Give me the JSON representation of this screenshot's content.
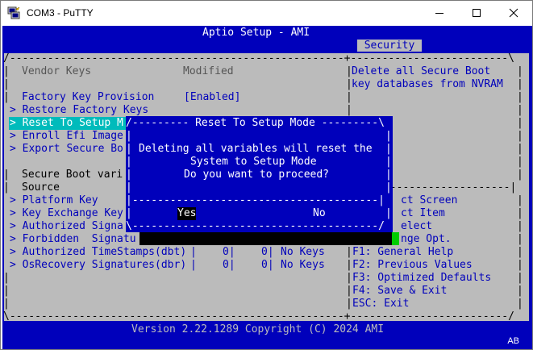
{
  "window": {
    "title": "COM3 - PuTTY"
  },
  "header": {
    "title": "Aptio Setup - AMI",
    "active_tab": "Security"
  },
  "main": {
    "col_header_left": "Vendor Keys",
    "col_header_value": "Modified",
    "help_line1": "Delete all Secure Boot",
    "help_line2": "key databases from NVRAM",
    "factory_key_provision": {
      "label": "Factory Key Provision",
      "value": "[Enabled]"
    },
    "restore_factory_keys": "> Restore Factory Keys",
    "reset_to_setup_mode": "> Reset To Setup M",
    "enroll_efi_image": "> Enroll Efi Image",
    "export_secure_boot": "> Export Secure Bo",
    "secure_boot_vari": "Secure Boot vari",
    "source": "Source",
    "platform_key": "> Platform Key",
    "key_exchange_key": "> Key Exchange Key",
    "authorized_signa": "> Authorized Signa",
    "forbidden_signatu": "> Forbidden  Signatu",
    "authorized_timestamps": {
      "label": "> Authorized TimeStamps(dbt)",
      "sep1": "|",
      "count1": "0|",
      "count2": "0|",
      "status": "No Keys"
    },
    "osrecovery_signatures": {
      "label": "> OsRecovery Signatures(dbr)",
      "sep1": "|",
      "count1": "0|",
      "count2": "0|",
      "status": "No Keys"
    },
    "nav_help": [
      "ct Screen",
      "ct Item",
      "elect",
      "nge Opt.",
      "F1: General Help",
      "F2: Previous Values",
      "F3: Optimized Defaults",
      "F4: Save & Exit",
      "ESC: Exit"
    ]
  },
  "dialog": {
    "title": "--------- Reset To Setup Mode ---------",
    "line1": "Deleting all variables will reset the",
    "line2": "System to Setup Mode",
    "line3": "Do you want to proceed?",
    "yes_label": "Yes",
    "no_label": "No"
  },
  "footer": {
    "version": "Version 2.22.1289 Copyright (C) 2024 AMI",
    "indicator": "AB"
  },
  "colors": {
    "bios_blue": "#0000bb",
    "bios_gray": "#bbbbbb",
    "bios_cyan": "#00bbbb",
    "bios_green": "#00cc00"
  }
}
